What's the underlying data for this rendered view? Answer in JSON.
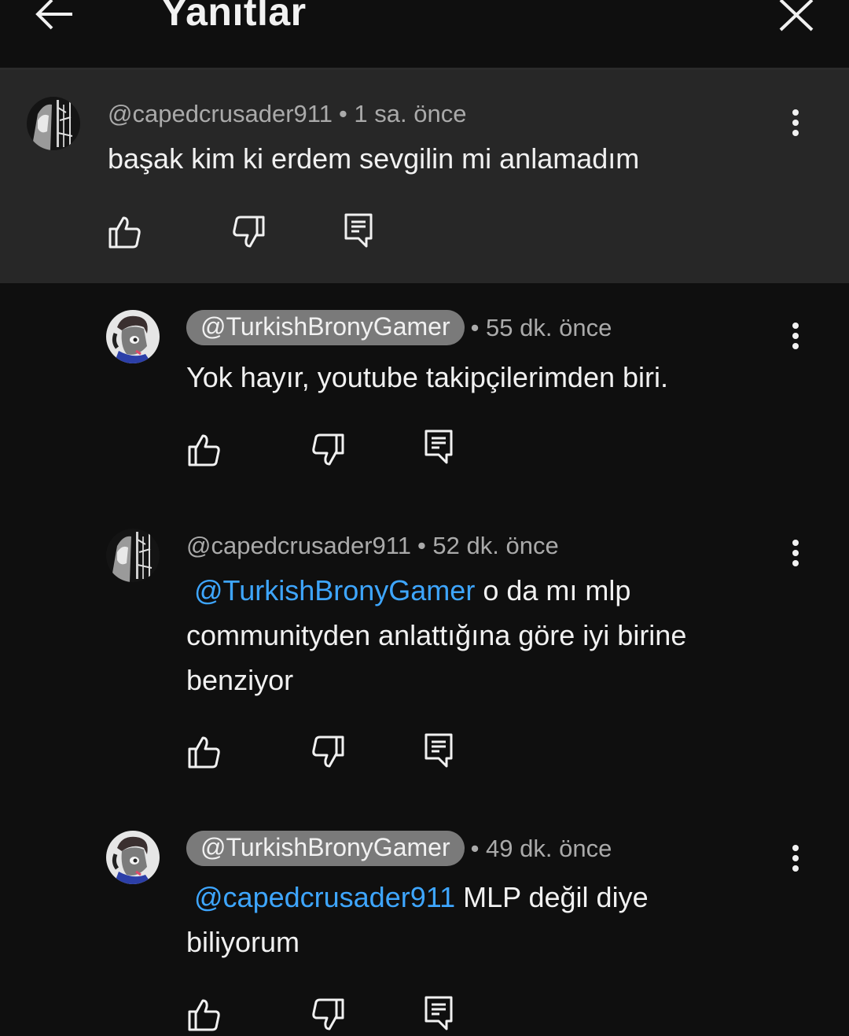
{
  "header": {
    "title": "Yanıtlar"
  },
  "comments": [
    {
      "author": "@capedcrusader911",
      "time": "• 1 sa. önce",
      "text": "başak kim ki erdem sevgilin mi anlamadım"
    },
    {
      "author": "@TurkishBronyGamer",
      "time": "• 55 dk. önce",
      "text": "Yok hayır, youtube takipçilerimden biri."
    },
    {
      "author": "@capedcrusader911",
      "time": "• 52 dk. önce",
      "mention": "@TurkishBronyGamer",
      "line1": " o da mı mlp",
      "line2": "communityden anlattığına göre iyi birine",
      "line3": "benziyor"
    },
    {
      "author": "@TurkishBronyGamer",
      "time": "• 49 dk. önce",
      "mention": "@capedcrusader911",
      "line1": "  MLP değil diye",
      "line2": "biliyorum"
    }
  ],
  "icons": {
    "back": "arrow-left-icon",
    "close": "close-icon",
    "like": "thumbs-up-icon",
    "dislike": "thumbs-down-icon",
    "reply": "reply-comment-icon",
    "more": "more-vertical-icon"
  },
  "colors": {
    "background": "#0f0f0f",
    "highlight": "#272727",
    "mention": "#3ea6ff",
    "meta": "#aaaaaa"
  }
}
